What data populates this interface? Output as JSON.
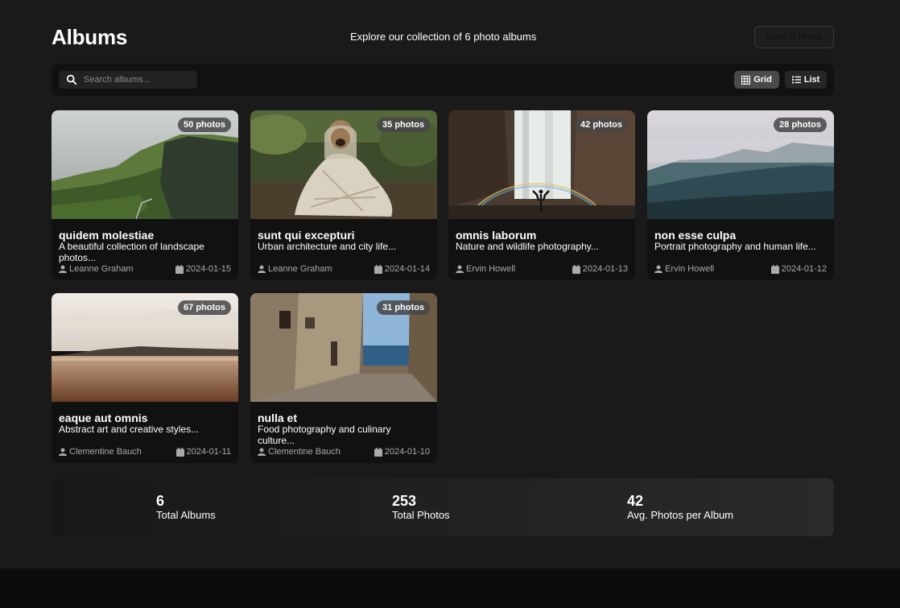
{
  "header": {
    "title": "Albums",
    "subtitle": "Explore our collection of 6 photo albums",
    "back_label": "Back to Home"
  },
  "toolbar": {
    "search_placeholder": "Search albums...",
    "grid_label": "Grid",
    "list_label": "List"
  },
  "albums": [
    {
      "title": "quidem molestiae",
      "description": "A beautiful collection of landscape photos...",
      "photos": "50 photos",
      "author": "Leanne Graham",
      "date": "2024-01-15",
      "image": "green-coastal-cliffs-landscape"
    },
    {
      "title": "sunt qui excepturi",
      "description": "Urban architecture and city life...",
      "photos": "35 photos",
      "author": "Leanne Graham",
      "date": "2024-01-14",
      "image": "pug-in-blanket-forest"
    },
    {
      "title": "omnis laborum",
      "description": "Nature and wildlife photography...",
      "photos": "42 photos",
      "author": "Ervin Howell",
      "date": "2024-01-13",
      "image": "waterfall-rainbow-person"
    },
    {
      "title": "non esse culpa",
      "description": "Portrait photography and human life...",
      "photos": "28 photos",
      "author": "Ervin Howell",
      "date": "2024-01-12",
      "image": "misty-mountain-forest"
    },
    {
      "title": "eaque aut omnis",
      "description": "Abstract art and creative styles...",
      "photos": "67 photos",
      "author": "Clementine Bauch",
      "date": "2024-01-11",
      "image": "calm-beach-sunset-reflection"
    },
    {
      "title": "nulla et",
      "description": "Food photography and culinary culture...",
      "photos": "31 photos",
      "author": "Clementine Bauch",
      "date": "2024-01-10",
      "image": "narrow-alley-to-sea"
    }
  ],
  "stats": {
    "total_albums": "6",
    "total_albums_label": "Total Albums",
    "total_photos": "253",
    "total_photos_label": "Total Photos",
    "avg_photos": "42",
    "avg_photos_label": "Avg. Photos per Album"
  },
  "colors": {
    "background": "#1a1a1a",
    "card": "#111111",
    "badge": "#464646",
    "active_toggle": "#4a4a4a"
  }
}
